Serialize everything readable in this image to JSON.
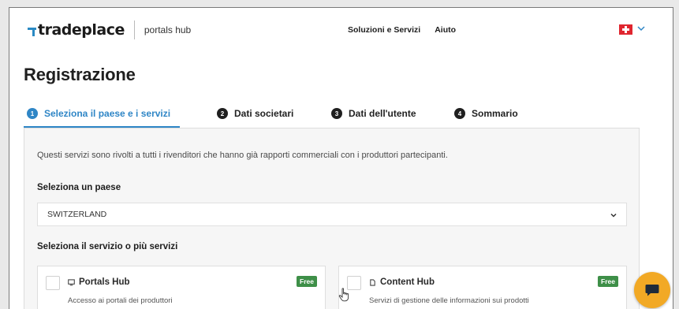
{
  "header": {
    "logo_text": "tradeplace",
    "logo_sub": "portals hub",
    "nav": [
      "Soluzioni e Servizi",
      "Aiuto"
    ],
    "language_icon": "swiss-flag-icon"
  },
  "page": {
    "title": "Registrazione"
  },
  "steps": [
    {
      "num": "1",
      "label": "Seleziona il paese e i servizi",
      "active": true
    },
    {
      "num": "2",
      "label": "Dati societari",
      "active": false
    },
    {
      "num": "3",
      "label": "Dati dell'utente",
      "active": false
    },
    {
      "num": "4",
      "label": "Sommario",
      "active": false
    }
  ],
  "form": {
    "intro": "Questi servizi sono rivolti a tutti i rivenditori che hanno già rapporti commerciali con i produttori partecipanti.",
    "country_label": "Seleziona un paese",
    "country_value": "SWITZERLAND",
    "services_label": "Seleziona il servizio o più servizi",
    "services": [
      {
        "name": "Portals Hub",
        "description": "Accesso ai portali dei produttori",
        "badge": "Free",
        "icon": "monitor-icon"
      },
      {
        "name": "Content Hub",
        "description": "Servizi di gestione delle informazioni sui prodotti",
        "badge": "Free",
        "icon": "document-icon"
      }
    ]
  },
  "colors": {
    "accent": "#2f86c6",
    "badge": "#3e8f48",
    "chat": "#f2a925",
    "flag": "#e0262f"
  }
}
